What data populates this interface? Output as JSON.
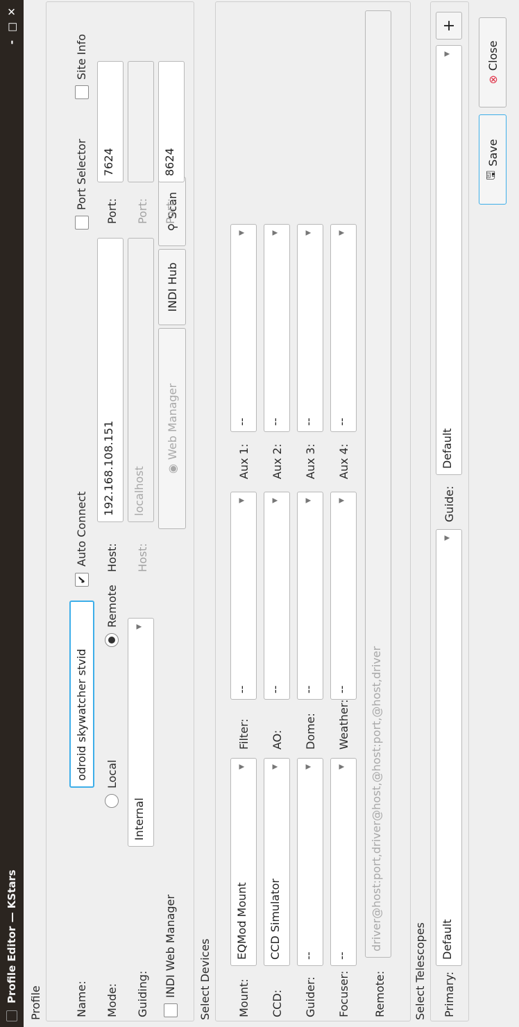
{
  "window": {
    "title": "Profile Editor — KStars",
    "minimize_glyph": "-",
    "maximize_glyph": "□",
    "close_glyph": "✕"
  },
  "profile": {
    "section_label": "Profile",
    "name_label": "Name:",
    "name_value": "odroid skywatcher stvid",
    "auto_connect_label": "Auto Connect",
    "auto_connect_checked": true,
    "port_selector_label": "Port Selector",
    "site_info_label": "Site Info",
    "mode_label": "Mode:",
    "mode_local": "Local",
    "mode_remote": "Remote",
    "mode_selected": "Remote",
    "host_label": "Host:",
    "host_value": "192.168.108.151",
    "port_label": "Port:",
    "port_value": "7624",
    "guiding_label": "Guiding:",
    "guiding_value": "Internal",
    "guide_host_label": "Host:",
    "guide_host_placeholder": "localhost",
    "guide_port_label": "Port:",
    "guide_port_value": "",
    "indi_web_manager_label": "INDI Web Manager",
    "web_manager_button": "Web Manager",
    "indi_hub_button": "INDI Hub",
    "scan_button": "Scan",
    "web_port_label": "Port:",
    "web_port_value": "8624"
  },
  "devices": {
    "section_label": "Select Devices",
    "mount_label": "Mount:",
    "mount_value": "EQMod Mount",
    "ccd_label": "CCD:",
    "ccd_value": "CCD Simulator",
    "guider_label": "Guider:",
    "guider_value": "--",
    "focuser_label": "Focuser:",
    "focuser_value": "--",
    "filter_label": "Filter:",
    "filter_value": "--",
    "ao_label": "AO:",
    "ao_value": "--",
    "dome_label": "Dome:",
    "dome_value": "--",
    "weather_label": "Weather:",
    "weather_value": "--",
    "aux1_label": "Aux 1:",
    "aux1_value": "--",
    "aux2_label": "Aux 2:",
    "aux2_value": "--",
    "aux3_label": "Aux 3:",
    "aux3_value": "--",
    "aux4_label": "Aux 4:",
    "aux4_value": "--",
    "remote_label": "Remote:",
    "remote_placeholder": "driver@host:port,driver@host,@host:port,@host,driver"
  },
  "telescopes": {
    "section_label": "Select Telescopes",
    "primary_label": "Primary:",
    "primary_value": "Default",
    "guide_label": "Guide:",
    "guide_value": "Default",
    "add_glyph": "+"
  },
  "footer": {
    "save_button": "Save",
    "close_button": "Close"
  },
  "colors": {
    "accent": "#3daee9",
    "titlebar": "#2b2520",
    "close_icon": "#e0344a"
  }
}
